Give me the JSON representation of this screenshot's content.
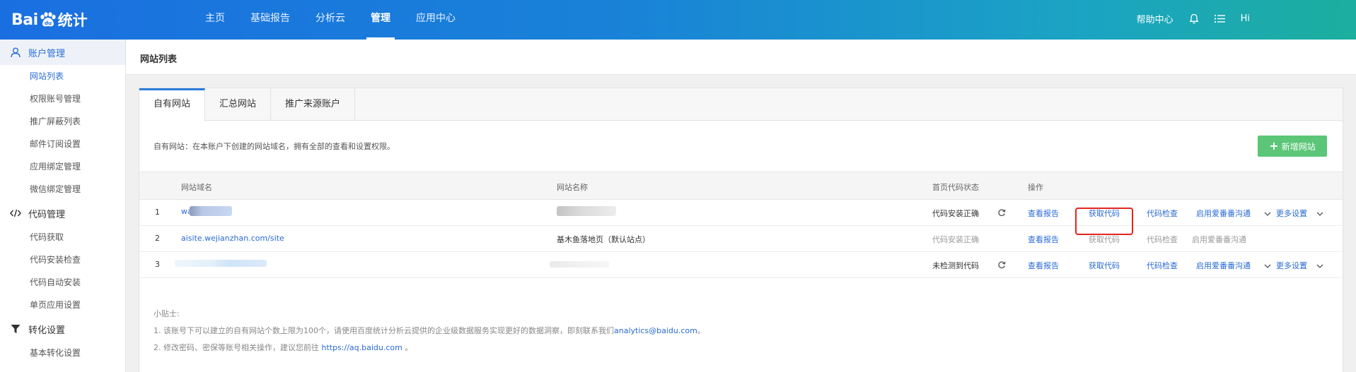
{
  "header": {
    "logo_text_left": "Bai",
    "logo_text_right": "统计",
    "nav": [
      "主页",
      "基础报告",
      "分析云",
      "管理",
      "应用中心"
    ],
    "nav_active_index": 3,
    "help": "帮助中心",
    "user": "Hi"
  },
  "sidebar": {
    "groups": [
      {
        "label": "账户管理",
        "icon": "user-icon",
        "items": [
          "网站列表",
          "权限账号管理",
          "推广屏蔽列表",
          "邮件订阅设置",
          "应用绑定管理",
          "微信绑定管理"
        ]
      },
      {
        "label": "代码管理",
        "icon": "code-icon",
        "items": [
          "代码获取",
          "代码安装检查",
          "代码自动安装",
          "单页应用设置"
        ]
      },
      {
        "label": "转化设置",
        "icon": "funnel-icon",
        "items": [
          "基本转化设置"
        ]
      }
    ]
  },
  "page": {
    "title": "网站列表",
    "tabs": [
      "自有网站",
      "汇总网站",
      "推广来源账户"
    ],
    "intro": "自有网站：在本账户下创建的网站域名，拥有全部的查看和设置权限。",
    "add_button": "新增网站"
  },
  "table": {
    "headers": {
      "domain": "网站域名",
      "name": "网站名称",
      "status": "首页代码状态",
      "ops": "操作"
    },
    "rows": [
      {
        "no": "1",
        "domain": "wa",
        "name": "",
        "status": "代码安装正确",
        "view": "查看报告",
        "get": "获取代码",
        "check": "代码检查",
        "share": "启用爱番番沟通",
        "more": "更多设置"
      },
      {
        "no": "2",
        "domain": "aisite.wejianzhan.com/site",
        "name": "基木鱼落地页（默认站点）",
        "status": "代码安装正确",
        "view": "查看报告",
        "get": "获取代码",
        "check": "代码检查",
        "share": "启用爱番番沟通",
        "more": ""
      },
      {
        "no": "3",
        "domain": "",
        "name": "",
        "status": "未检测到代码",
        "view": "查看报告",
        "get": "获取代码",
        "check": "代码检查",
        "share": "启用爱番番沟通",
        "more": "更多设置"
      }
    ]
  },
  "tips": {
    "title": "小贴士:",
    "line1_prefix": "1. 该账号下可以建立的自有网站个数上限为100个，请使用百度统计分析云提供的企业级数据服务实现更好的数据洞察，即刻联系我们",
    "line1_link": "analytics@baidu.com",
    "line1_suffix": "。",
    "line2_prefix": "2. 修改密码、密保等账号相关操作，建议您前往 ",
    "line2_link": "https://aq.baidu.com",
    "line2_suffix": " 。"
  },
  "colors": {
    "accent": "#2b6fd8",
    "primary_button": "#5bc678",
    "highlight": "#e3251f"
  }
}
